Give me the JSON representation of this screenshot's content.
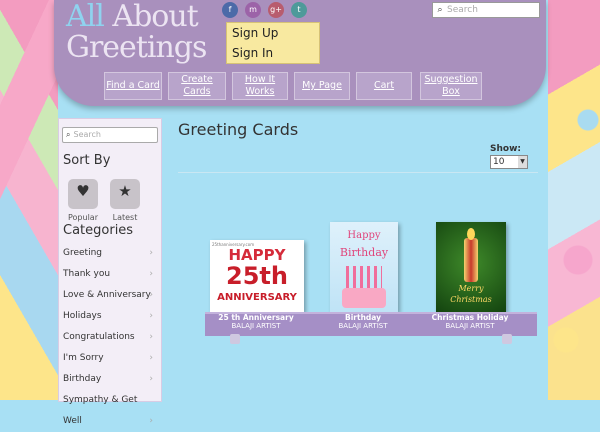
{
  "header": {
    "logo_line1_a": "All",
    "logo_line1_b": "About",
    "logo_line2": "Greetings",
    "social": [
      "f",
      "m",
      "g+",
      "t"
    ],
    "sign_up": "Sign Up",
    "sign_in": "Sign In",
    "search_placeholder": "Search"
  },
  "nav": [
    {
      "label": "Find a Card"
    },
    {
      "label": "Create Cards"
    },
    {
      "label": "How It Works"
    },
    {
      "label": "My Page"
    },
    {
      "label": "Cart"
    },
    {
      "label": "Suggestion Box"
    }
  ],
  "sidebar": {
    "search_placeholder": "Search",
    "sort_title": "Sort By",
    "sort_popular": "Popular",
    "sort_latest": "Latest",
    "categories_title": "Categories",
    "categories": [
      "Greeting",
      "Thank you",
      "Love & Anniversary",
      "Holidays",
      "Congratulations",
      "I'm Sorry",
      "Birthday",
      "Sympathy & Get Well"
    ]
  },
  "main": {
    "title": "Greeting Cards",
    "show_label": "Show:",
    "show_value": "10",
    "cards": [
      {
        "name": "25 th Anniversary",
        "artist": "BALAJI ARTIST",
        "art_top": "HAPPY",
        "art_big": "25th",
        "art_bottom": "ANNIVERSARY",
        "art_small": "25thanniversary.com"
      },
      {
        "name": "Birthday",
        "artist": "BALAJI ARTIST",
        "art_top": "Happy",
        "art_bottom": "Birthday"
      },
      {
        "name": "Christmas Holiday",
        "artist": "BALAJI ARTIST",
        "art_top": "Merry",
        "art_bottom": "Christmas"
      }
    ]
  },
  "colors": {
    "header_bg": "#a990bd",
    "shelf": "#a58fc6",
    "page_bg": "#a8e0f4"
  }
}
